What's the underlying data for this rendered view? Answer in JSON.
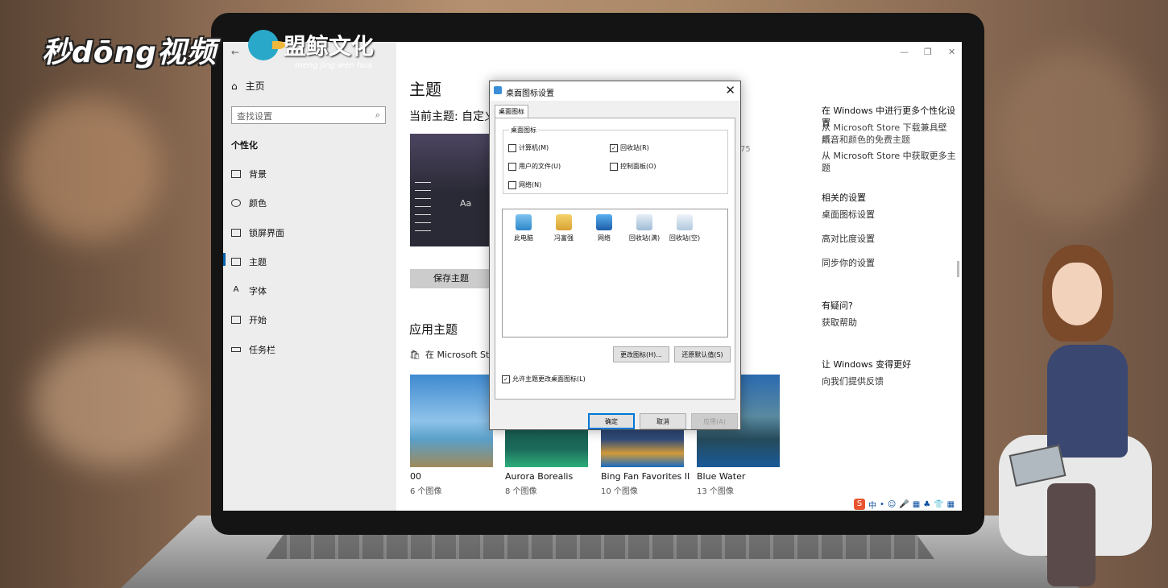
{
  "watermark": {
    "left_brand": "秒dōng视频",
    "logo_title": "盟鲸文化",
    "logo_sub": "meng jing wen hua"
  },
  "window": {
    "back_arrow": "←",
    "controls": [
      "—",
      "❐",
      "✕"
    ]
  },
  "sidebar": {
    "home": "主页",
    "search_placeholder": "查找设置",
    "category": "个性化",
    "items": [
      {
        "label": "背景",
        "icon": "picture-icon"
      },
      {
        "label": "颜色",
        "icon": "palette-icon"
      },
      {
        "label": "锁屏界面",
        "icon": "lockscreen-icon"
      },
      {
        "label": "主题",
        "icon": "theme-icon",
        "active": true
      },
      {
        "label": "字体",
        "icon": "font-icon"
      },
      {
        "label": "开始",
        "icon": "start-icon"
      },
      {
        "label": "任务栏",
        "icon": "taskbar-icon"
      }
    ]
  },
  "main": {
    "title": "主题",
    "current_theme": "当前主题: 自定义",
    "preview_aa": "Aa",
    "partial_number": "75",
    "save_button": "保存主题",
    "apply_heading": "应用主题",
    "store_link": "在 Microsoft Store",
    "themes": [
      {
        "name": "00",
        "count": "6 个图像"
      },
      {
        "name": "Aurora Borealis",
        "count": "8 个图像"
      },
      {
        "name": "Bing Fan Favorites II",
        "count": "10 个图像"
      },
      {
        "name": "Blue Water",
        "count": "13 个图像"
      }
    ]
  },
  "right": {
    "more_heading": "在 Windows 中进行更多个性化设置",
    "more_text1": "从 Microsoft Store 下载兼具壁纸、",
    "more_text2": "声音和颜色的免费主题",
    "more_link": "从 Microsoft Store 中获取更多主题",
    "related_heading": "相关的设置",
    "related": [
      "桌面图标设置",
      "高对比度设置",
      "同步你的设置"
    ],
    "question_heading": "有疑问?",
    "question_link": "获取帮助",
    "improve_heading": "让 Windows 变得更好",
    "improve_link": "向我们提供反馈"
  },
  "taskbar": {
    "items": [
      "S",
      "中",
      "•",
      "☺",
      "🎤",
      "▦",
      "♣",
      "👕",
      "▦"
    ]
  },
  "dialog": {
    "title": "桌面图标设置",
    "close": "✕",
    "tab": "桌面图标",
    "group_label": "桌面图标",
    "checkboxes": [
      {
        "label": "计算机(M)",
        "checked": false
      },
      {
        "label": "回收站(R)",
        "checked": true
      },
      {
        "label": "用户的文件(U)",
        "checked": false
      },
      {
        "label": "控制面板(O)",
        "checked": false
      },
      {
        "label": "网络(N)",
        "checked": false
      }
    ],
    "icons": [
      {
        "label": "此电脑",
        "icon": "computer-icon"
      },
      {
        "label": "冯富强",
        "icon": "user-folder-icon"
      },
      {
        "label": "网络",
        "icon": "network-icon"
      },
      {
        "label": "回收站(满)",
        "icon": "recycle-bin-full-icon"
      },
      {
        "label": "回收站(空)",
        "icon": "recycle-bin-empty-icon"
      }
    ],
    "change_icon_button": "更改图标(H)...",
    "restore_default_button": "还原默认值(S)",
    "allow_themes_label": "允许主题更改桌面图标(L)",
    "allow_themes_checked": true,
    "ok_button": "确定",
    "cancel_button": "取消",
    "apply_button": "应用(A)"
  },
  "colors": {
    "accent": "#0078d7",
    "sidebar_bg": "#ededed",
    "dialog_bg": "#f0f0f0"
  }
}
